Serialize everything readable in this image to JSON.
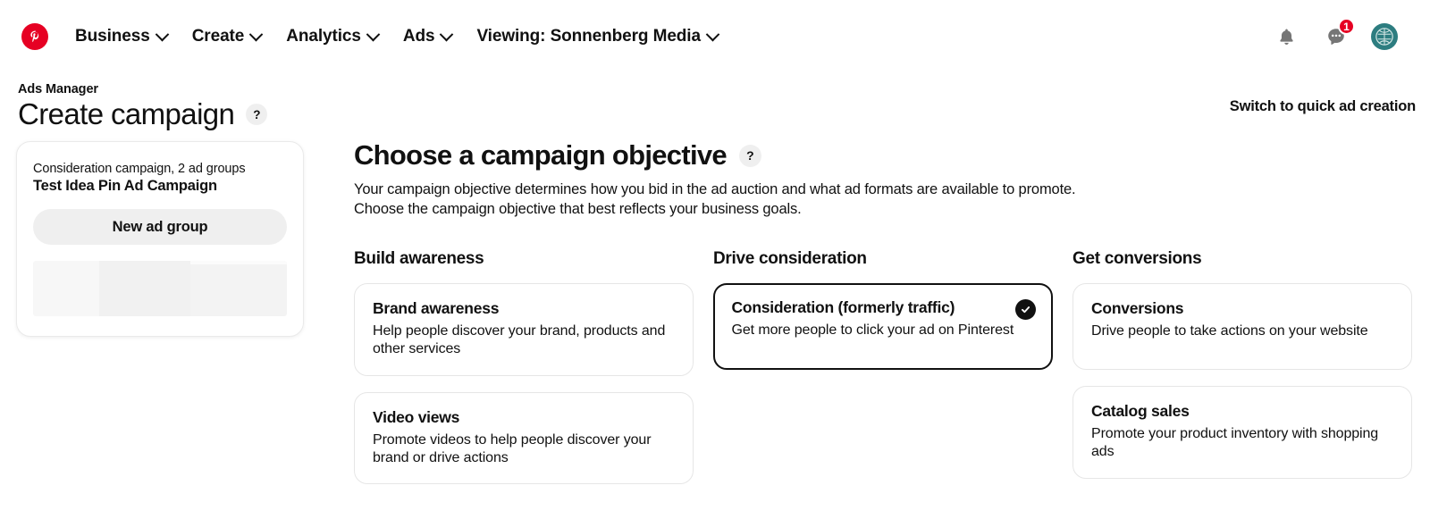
{
  "nav": {
    "logo_icon": "pinterest-logo-icon",
    "items": [
      {
        "label": "Business",
        "caret": true
      },
      {
        "label": "Create",
        "caret": true
      },
      {
        "label": "Analytics",
        "caret": true
      },
      {
        "label": "Ads",
        "caret": true
      },
      {
        "label": "Viewing: Sonnenberg Media",
        "caret": true
      }
    ],
    "right": {
      "bell_icon": "notifications-bell-icon",
      "messages_icon": "messages-chat-icon",
      "messages_badge": "1",
      "avatar_icon": "user-avatar-icon"
    }
  },
  "header": {
    "eyebrow": "Ads Manager",
    "title": "Create campaign",
    "help": "?",
    "switch_link": "Switch to quick ad creation"
  },
  "sidebar": {
    "campaign_meta": "Consideration campaign, 2 ad groups",
    "campaign_name": "Test Idea Pin Ad Campaign",
    "new_ad_group_label": "New ad group"
  },
  "main": {
    "title": "Choose a campaign objective",
    "help": "?",
    "description_line1": "Your campaign objective determines how you bid in the ad auction and what ad formats are available to promote.",
    "description_line2": "Choose the campaign objective that best reflects your business goals.",
    "columns": [
      {
        "heading": "Build awareness",
        "cards": [
          {
            "title": "Brand awareness",
            "desc": "Help people discover your brand, products and other services",
            "selected": false
          },
          {
            "title": "Video views",
            "desc": "Promote videos to help people discover your brand or drive actions",
            "selected": false
          }
        ]
      },
      {
        "heading": "Drive consideration",
        "cards": [
          {
            "title": "Consideration (formerly traffic)",
            "desc": "Get more people to click your ad on Pinterest",
            "selected": true
          }
        ]
      },
      {
        "heading": "Get conversions",
        "cards": [
          {
            "title": "Conversions",
            "desc": "Drive people to take actions on your website",
            "selected": false
          },
          {
            "title": "Catalog sales",
            "desc": "Promote your product inventory with shopping ads",
            "selected": false
          }
        ]
      }
    ]
  },
  "colors": {
    "brand_red": "#e60023",
    "avatar_teal": "#2d7d80",
    "selected_border": "#111111"
  }
}
